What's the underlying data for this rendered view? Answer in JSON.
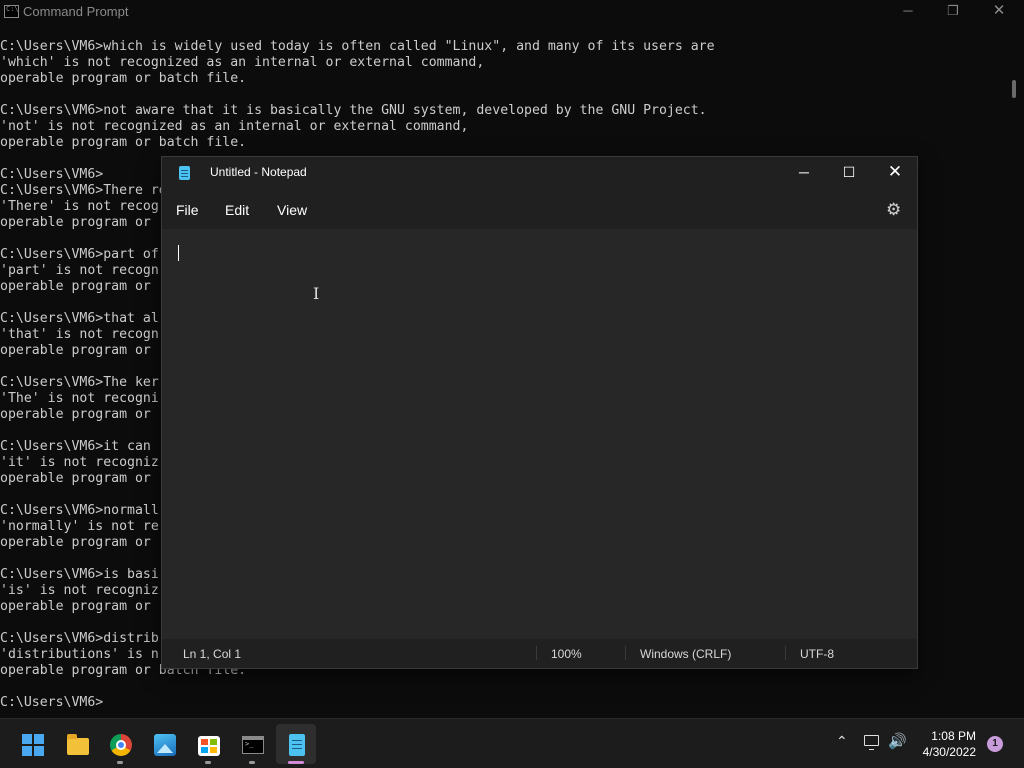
{
  "cmd": {
    "title": "Command Prompt",
    "icon": "cmd-icon",
    "icon_text": "C:\\",
    "controls": {
      "minimize": "─",
      "maximize": "❐",
      "close": "✕"
    },
    "lines": [
      "C:\\Users\\VM6>which is widely used today is often called \"Linux\", and many of its users are",
      "'which' is not recognized as an internal or external command,",
      "operable program or batch file.",
      "",
      "C:\\Users\\VM6>not aware that it is basically the GNU system, developed by the GNU Project.",
      "'not' is not recognized as an internal or external command,",
      "operable program or batch file.",
      "",
      "C:\\Users\\VM6>",
      "C:\\Users\\VM6>There re",
      "'There' is not recog",
      "operable program or ",
      "",
      "C:\\Users\\VM6>part of",
      "'part' is not recogn",
      "operable program or ",
      "",
      "C:\\Users\\VM6>that al",
      "'that' is not recogn",
      "operable program or ",
      "",
      "C:\\Users\\VM6>The ker",
      "'The' is not recogni",
      "operable program or ",
      "",
      "C:\\Users\\VM6>it can ",
      "'it' is not recogniz",
      "operable program or ",
      "",
      "C:\\Users\\VM6>normall",
      "'normally' is not re",
      "operable program or ",
      "",
      "C:\\Users\\VM6>is basi",
      "'is' is not recogniz",
      "operable program or ",
      "",
      "C:\\Users\\VM6>distrib",
      "'distributions' is n",
      "operable program or batch file.",
      "",
      "C:\\Users\\VM6>"
    ]
  },
  "notepad": {
    "title": "Untitled - Notepad",
    "icon": "notepad-icon",
    "controls": {
      "minimize": "─",
      "maximize": "☐",
      "close": "✕"
    },
    "menu": {
      "file": "File",
      "edit": "Edit",
      "view": "View"
    },
    "settings_icon": "⚙",
    "content": "",
    "status": {
      "position": "Ln 1, Col 1",
      "zoom": "100%",
      "line_endings": "Windows (CRLF)",
      "encoding": "UTF-8"
    }
  },
  "taskbar": {
    "apps": [
      {
        "name": "start-icon"
      },
      {
        "name": "file-explorer-icon"
      },
      {
        "name": "chrome-icon"
      },
      {
        "name": "photos-icon"
      },
      {
        "name": "microsoft-store-icon"
      },
      {
        "name": "terminal-icon",
        "terminal_text": ">_"
      },
      {
        "name": "notepad-icon",
        "active": true
      }
    ],
    "tray": {
      "chevron": "⌃",
      "volume": "🔊",
      "time": "1:08 PM",
      "date": "4/30/2022",
      "notification_count": "1"
    }
  }
}
